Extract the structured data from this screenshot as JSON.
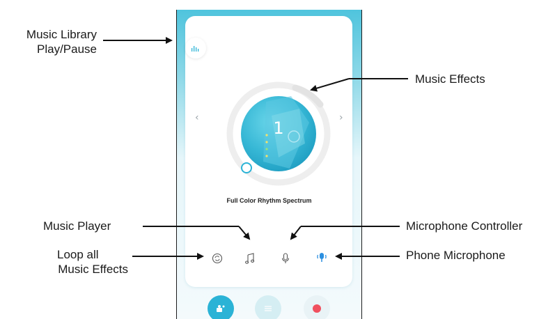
{
  "annotations": {
    "music_library": [
      "Music Library",
      "Play/Pause"
    ],
    "music_effects": "Music Effects",
    "music_player": "Music Player",
    "microphone_controller": "Microphone Controller",
    "loop_all": [
      "Loop all",
      "Music Effects"
    ],
    "phone_microphone": "Phone Microphone"
  },
  "app": {
    "effect_number": "1",
    "effect_name": "Full Color Rhythm Spectrum",
    "prev_arrow": "‹",
    "next_arrow": "›"
  },
  "icons": {
    "library": "bar-chart-icon",
    "loop": "loop-icon",
    "music": "music-note-icon",
    "mic": "microphone-icon",
    "phone_mic": "phone-microphone-icon",
    "scene": "scene-icon",
    "adjust": "adjust-icon",
    "record": "record-icon"
  },
  "colors": {
    "accent": "#2bb3d6",
    "record": "#f0505e"
  }
}
